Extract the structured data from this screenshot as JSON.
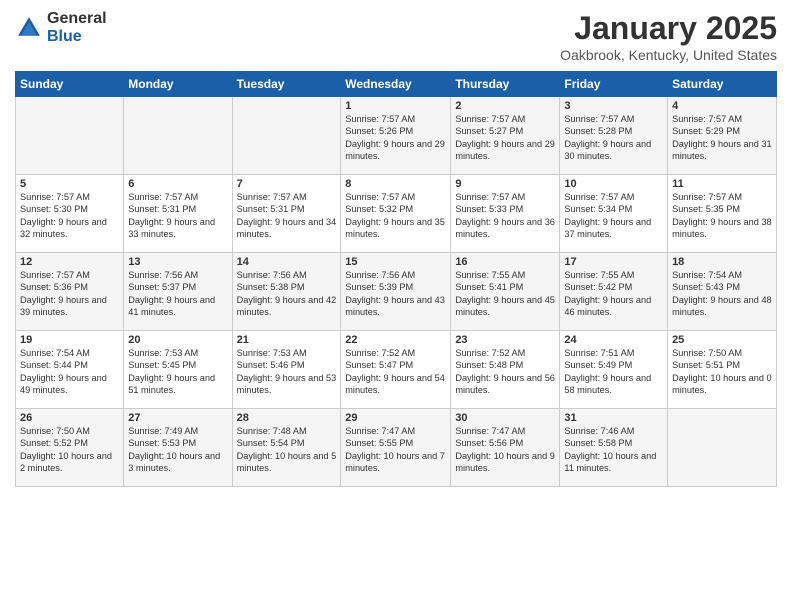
{
  "logo": {
    "general": "General",
    "blue": "Blue"
  },
  "title": "January 2025",
  "location": "Oakbrook, Kentucky, United States",
  "headers": [
    "Sunday",
    "Monday",
    "Tuesday",
    "Wednesday",
    "Thursday",
    "Friday",
    "Saturday"
  ],
  "weeks": [
    [
      {
        "day": "",
        "sunrise": "",
        "sunset": "",
        "daylight": ""
      },
      {
        "day": "",
        "sunrise": "",
        "sunset": "",
        "daylight": ""
      },
      {
        "day": "",
        "sunrise": "",
        "sunset": "",
        "daylight": ""
      },
      {
        "day": "1",
        "sunrise": "Sunrise: 7:57 AM",
        "sunset": "Sunset: 5:26 PM",
        "daylight": "Daylight: 9 hours and 29 minutes."
      },
      {
        "day": "2",
        "sunrise": "Sunrise: 7:57 AM",
        "sunset": "Sunset: 5:27 PM",
        "daylight": "Daylight: 9 hours and 29 minutes."
      },
      {
        "day": "3",
        "sunrise": "Sunrise: 7:57 AM",
        "sunset": "Sunset: 5:28 PM",
        "daylight": "Daylight: 9 hours and 30 minutes."
      },
      {
        "day": "4",
        "sunrise": "Sunrise: 7:57 AM",
        "sunset": "Sunset: 5:29 PM",
        "daylight": "Daylight: 9 hours and 31 minutes."
      }
    ],
    [
      {
        "day": "5",
        "sunrise": "Sunrise: 7:57 AM",
        "sunset": "Sunset: 5:30 PM",
        "daylight": "Daylight: 9 hours and 32 minutes."
      },
      {
        "day": "6",
        "sunrise": "Sunrise: 7:57 AM",
        "sunset": "Sunset: 5:31 PM",
        "daylight": "Daylight: 9 hours and 33 minutes."
      },
      {
        "day": "7",
        "sunrise": "Sunrise: 7:57 AM",
        "sunset": "Sunset: 5:31 PM",
        "daylight": "Daylight: 9 hours and 34 minutes."
      },
      {
        "day": "8",
        "sunrise": "Sunrise: 7:57 AM",
        "sunset": "Sunset: 5:32 PM",
        "daylight": "Daylight: 9 hours and 35 minutes."
      },
      {
        "day": "9",
        "sunrise": "Sunrise: 7:57 AM",
        "sunset": "Sunset: 5:33 PM",
        "daylight": "Daylight: 9 hours and 36 minutes."
      },
      {
        "day": "10",
        "sunrise": "Sunrise: 7:57 AM",
        "sunset": "Sunset: 5:34 PM",
        "daylight": "Daylight: 9 hours and 37 minutes."
      },
      {
        "day": "11",
        "sunrise": "Sunrise: 7:57 AM",
        "sunset": "Sunset: 5:35 PM",
        "daylight": "Daylight: 9 hours and 38 minutes."
      }
    ],
    [
      {
        "day": "12",
        "sunrise": "Sunrise: 7:57 AM",
        "sunset": "Sunset: 5:36 PM",
        "daylight": "Daylight: 9 hours and 39 minutes."
      },
      {
        "day": "13",
        "sunrise": "Sunrise: 7:56 AM",
        "sunset": "Sunset: 5:37 PM",
        "daylight": "Daylight: 9 hours and 41 minutes."
      },
      {
        "day": "14",
        "sunrise": "Sunrise: 7:56 AM",
        "sunset": "Sunset: 5:38 PM",
        "daylight": "Daylight: 9 hours and 42 minutes."
      },
      {
        "day": "15",
        "sunrise": "Sunrise: 7:56 AM",
        "sunset": "Sunset: 5:39 PM",
        "daylight": "Daylight: 9 hours and 43 minutes."
      },
      {
        "day": "16",
        "sunrise": "Sunrise: 7:55 AM",
        "sunset": "Sunset: 5:41 PM",
        "daylight": "Daylight: 9 hours and 45 minutes."
      },
      {
        "day": "17",
        "sunrise": "Sunrise: 7:55 AM",
        "sunset": "Sunset: 5:42 PM",
        "daylight": "Daylight: 9 hours and 46 minutes."
      },
      {
        "day": "18",
        "sunrise": "Sunrise: 7:54 AM",
        "sunset": "Sunset: 5:43 PM",
        "daylight": "Daylight: 9 hours and 48 minutes."
      }
    ],
    [
      {
        "day": "19",
        "sunrise": "Sunrise: 7:54 AM",
        "sunset": "Sunset: 5:44 PM",
        "daylight": "Daylight: 9 hours and 49 minutes."
      },
      {
        "day": "20",
        "sunrise": "Sunrise: 7:53 AM",
        "sunset": "Sunset: 5:45 PM",
        "daylight": "Daylight: 9 hours and 51 minutes."
      },
      {
        "day": "21",
        "sunrise": "Sunrise: 7:53 AM",
        "sunset": "Sunset: 5:46 PM",
        "daylight": "Daylight: 9 hours and 53 minutes."
      },
      {
        "day": "22",
        "sunrise": "Sunrise: 7:52 AM",
        "sunset": "Sunset: 5:47 PM",
        "daylight": "Daylight: 9 hours and 54 minutes."
      },
      {
        "day": "23",
        "sunrise": "Sunrise: 7:52 AM",
        "sunset": "Sunset: 5:48 PM",
        "daylight": "Daylight: 9 hours and 56 minutes."
      },
      {
        "day": "24",
        "sunrise": "Sunrise: 7:51 AM",
        "sunset": "Sunset: 5:49 PM",
        "daylight": "Daylight: 9 hours and 58 minutes."
      },
      {
        "day": "25",
        "sunrise": "Sunrise: 7:50 AM",
        "sunset": "Sunset: 5:51 PM",
        "daylight": "Daylight: 10 hours and 0 minutes."
      }
    ],
    [
      {
        "day": "26",
        "sunrise": "Sunrise: 7:50 AM",
        "sunset": "Sunset: 5:52 PM",
        "daylight": "Daylight: 10 hours and 2 minutes."
      },
      {
        "day": "27",
        "sunrise": "Sunrise: 7:49 AM",
        "sunset": "Sunset: 5:53 PM",
        "daylight": "Daylight: 10 hours and 3 minutes."
      },
      {
        "day": "28",
        "sunrise": "Sunrise: 7:48 AM",
        "sunset": "Sunset: 5:54 PM",
        "daylight": "Daylight: 10 hours and 5 minutes."
      },
      {
        "day": "29",
        "sunrise": "Sunrise: 7:47 AM",
        "sunset": "Sunset: 5:55 PM",
        "daylight": "Daylight: 10 hours and 7 minutes."
      },
      {
        "day": "30",
        "sunrise": "Sunrise: 7:47 AM",
        "sunset": "Sunset: 5:56 PM",
        "daylight": "Daylight: 10 hours and 9 minutes."
      },
      {
        "day": "31",
        "sunrise": "Sunrise: 7:46 AM",
        "sunset": "Sunset: 5:58 PM",
        "daylight": "Daylight: 10 hours and 11 minutes."
      },
      {
        "day": "",
        "sunrise": "",
        "sunset": "",
        "daylight": ""
      }
    ]
  ]
}
